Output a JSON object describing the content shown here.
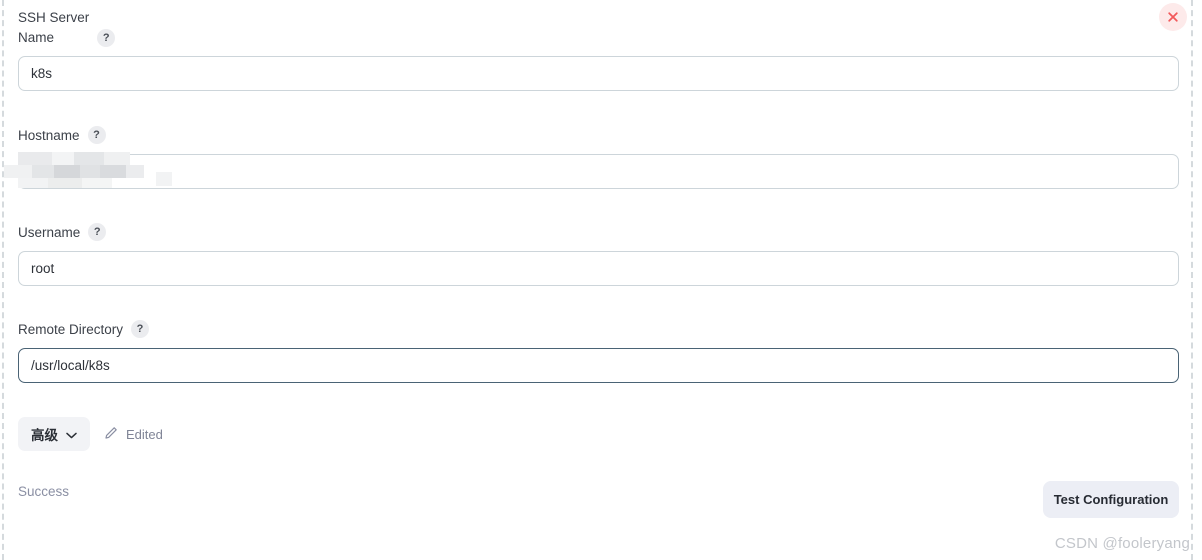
{
  "dialog": {
    "close_icon": "close-icon"
  },
  "fields": [
    {
      "key": "name",
      "label": "SSH Server\nName",
      "help": "?",
      "value": "k8s",
      "placeholder": "",
      "focused": false
    },
    {
      "key": "hostname",
      "label": "Hostname",
      "help": "?",
      "value": "",
      "placeholder": "",
      "focused": false,
      "redacted": true
    },
    {
      "key": "username",
      "label": "Username",
      "help": "?",
      "value": "root",
      "placeholder": "",
      "focused": false
    },
    {
      "key": "remote_directory",
      "label": "Remote Directory",
      "help": "?",
      "value": "/usr/local/k8s",
      "placeholder": "",
      "focused": true
    }
  ],
  "advanced": {
    "label": "高级",
    "chevron_icon": "chevron-down-icon"
  },
  "edited": {
    "label": "Edited",
    "icon": "pencil-icon"
  },
  "status": {
    "text": "Success"
  },
  "actions": {
    "test_configuration": "Test Configuration"
  },
  "watermark": {
    "text": "CSDN @fooleryang"
  },
  "colors": {
    "close_bg": "#fdeaea",
    "close_x": "#f2595b",
    "input_border": "#cdd5da",
    "input_border_focus": "#4a6375",
    "advanced_bg": "#f2f3f6",
    "test_btn_bg": "#eceef5",
    "status_text": "#8a8fa3",
    "panel_dash": "#d5dadd"
  }
}
